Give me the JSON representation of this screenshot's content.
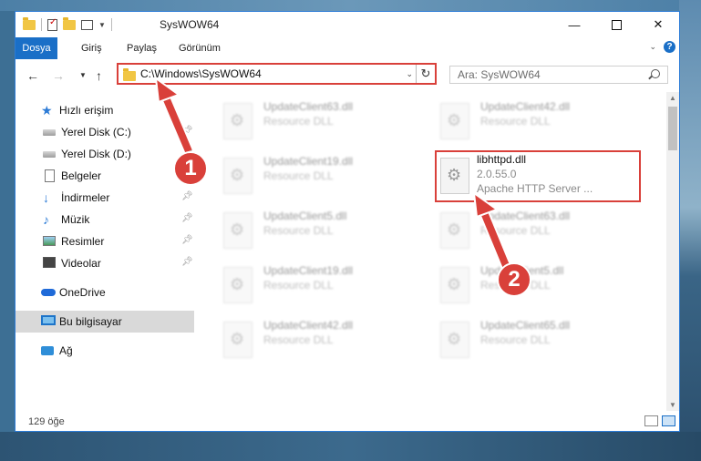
{
  "window": {
    "title": "SysWOW64",
    "ribbon_tabs": [
      "Dosya",
      "Giriş",
      "Paylaş",
      "Görünüm"
    ],
    "help_glyph": "?"
  },
  "address": {
    "path": "C:\\Windows\\SysWOW64",
    "search_placeholder": "Ara: SysWOW64"
  },
  "sidebar": {
    "items": [
      {
        "label": "Hızlı erişim",
        "icon": "star-icon"
      },
      {
        "label": "Yerel Disk (C:)",
        "icon": "drive-icon",
        "pinned": true
      },
      {
        "label": "Yerel Disk (D:)",
        "icon": "drive-icon",
        "pinned": true
      },
      {
        "label": "Belgeler",
        "icon": "document-icon",
        "pinned": true
      },
      {
        "label": "İndirmeler",
        "icon": "download-icon",
        "pinned": true
      },
      {
        "label": "Müzik",
        "icon": "music-icon",
        "pinned": true
      },
      {
        "label": "Resimler",
        "icon": "pictures-icon",
        "pinned": true
      },
      {
        "label": "Videolar",
        "icon": "video-icon",
        "pinned": true
      },
      {
        "label": "OneDrive",
        "icon": "cloud-icon"
      },
      {
        "label": "Bu bilgisayar",
        "icon": "computer-icon",
        "selected": true
      },
      {
        "label": "Ağ",
        "icon": "network-icon"
      }
    ]
  },
  "files": [
    {
      "name": "UpdateClient63.dll",
      "desc": "Resource DLL"
    },
    {
      "name": "UpdateClient42.dll",
      "desc": "Resource DLL"
    },
    {
      "name": "UpdateClient19.dll",
      "desc": "Resource DLL"
    },
    {
      "name": "libhttpd.dll",
      "desc": "2.0.55.0",
      "desc2": "Apache HTTP Server ..."
    },
    {
      "name": "UpdateClient5.dll",
      "desc": "Resource DLL"
    },
    {
      "name": "UpdateClient63.dll",
      "desc": "Resource DLL"
    },
    {
      "name": "UpdateClient19.dll",
      "desc": "Resource DLL"
    },
    {
      "name": "UpdateClient5.dll",
      "desc": "Resource DLL"
    },
    {
      "name": "UpdateClient42.dll",
      "desc": "Resource DLL"
    },
    {
      "name": "UpdateClient65.dll",
      "desc": "Resource DLL"
    }
  ],
  "status": {
    "item_count": "129 öğe"
  },
  "annotations": {
    "step1": "1",
    "step2": "2",
    "color": "#d9403a"
  }
}
